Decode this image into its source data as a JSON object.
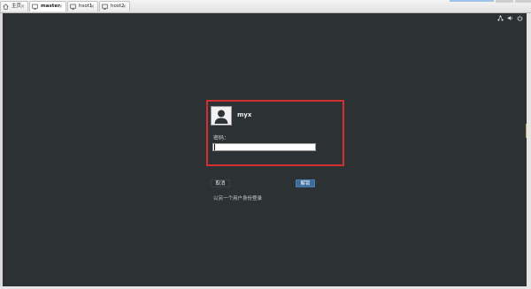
{
  "tabs": [
    {
      "label": "主页",
      "icon": "home-icon",
      "close": "×"
    },
    {
      "label": "master",
      "icon": "vm-icon",
      "close": "×"
    },
    {
      "label": "hsot1",
      "icon": "vm-icon",
      "close": "×"
    },
    {
      "label": "host2",
      "icon": "vm-icon",
      "close": "×"
    }
  ],
  "status_icons": [
    "network-icon",
    "volume-icon",
    "power-icon"
  ],
  "lock": {
    "username": "myx",
    "password_label": "密码：",
    "password_value": "",
    "cancel_label": "取消",
    "unlock_label": "解锁",
    "switch_user_label": "以另一个用户身份登录"
  },
  "colors": {
    "screen_bg": "#2c3134",
    "highlight": "#d32f2f",
    "primary_button": "#3b6a9c"
  }
}
